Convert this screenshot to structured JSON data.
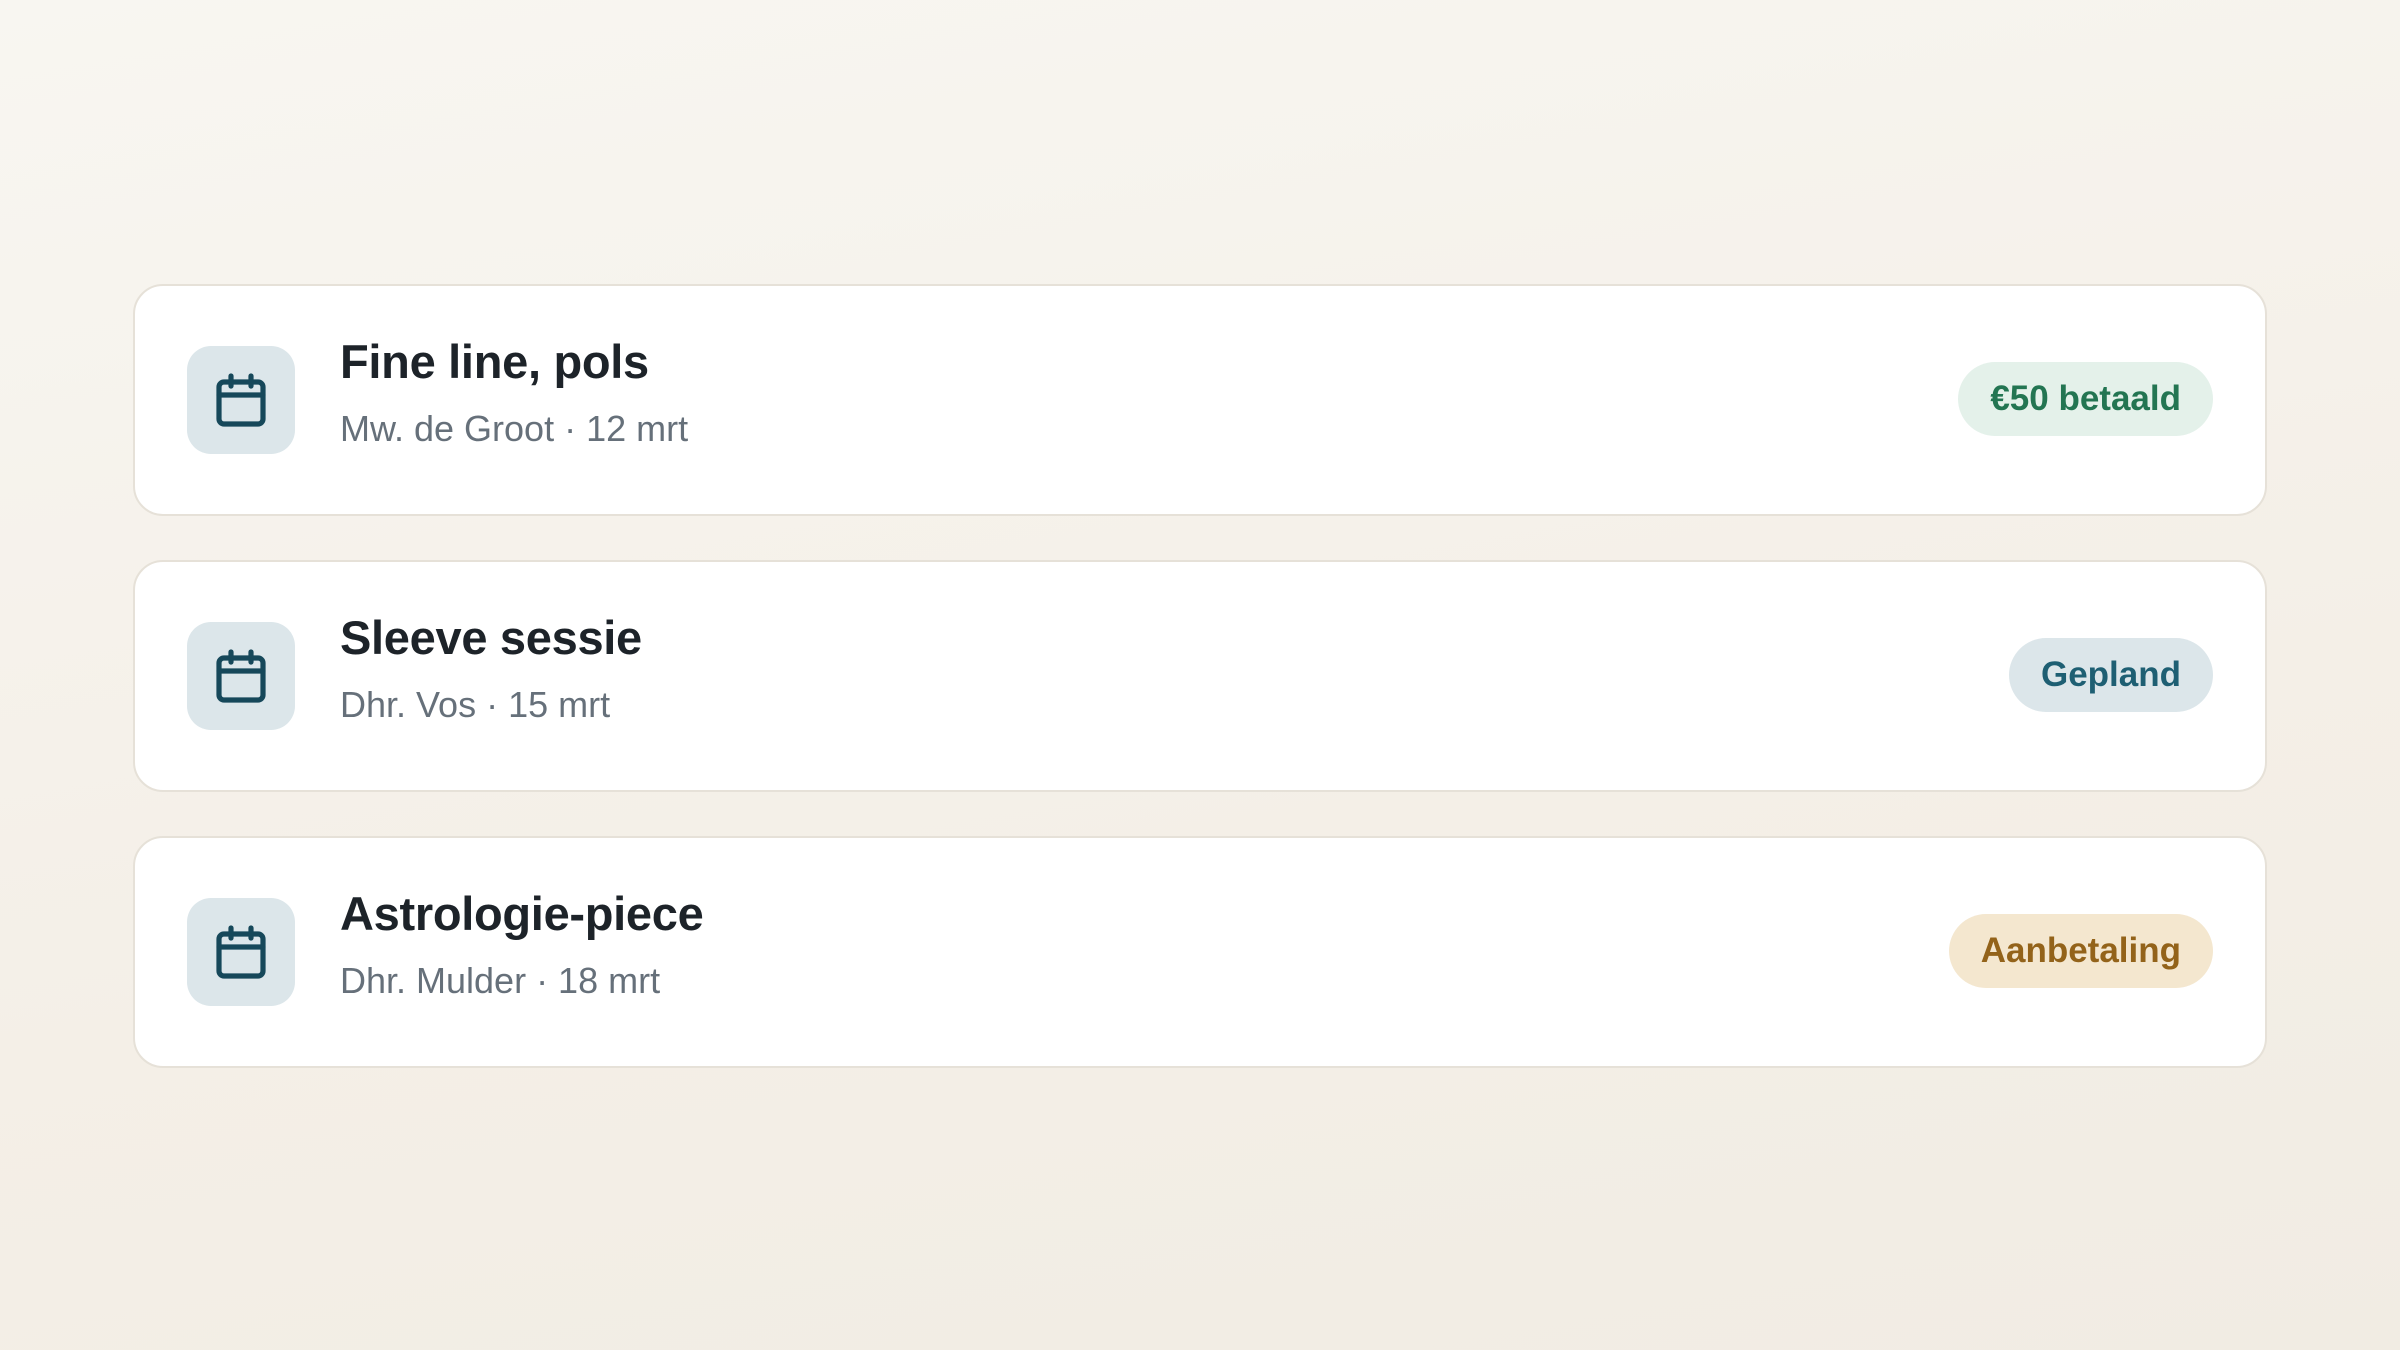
{
  "appointments": [
    {
      "title": "Fine line, pols",
      "client": "Mw. de Groot",
      "date": "12 mrt",
      "subtitle": "Mw. de Groot · 12 mrt",
      "status": "€50 betaald",
      "status_type": "paid",
      "icon": "calendar-icon"
    },
    {
      "title": "Sleeve sessie",
      "client": "Dhr. Vos",
      "date": "15 mrt",
      "subtitle": "Dhr. Vos · 15 mrt",
      "status": "Gepland",
      "status_type": "planned",
      "icon": "calendar-icon"
    },
    {
      "title": "Astrologie-piece",
      "client": "Dhr. Mulder",
      "date": "18 mrt",
      "subtitle": "Dhr. Mulder · 18 mrt",
      "status": "Aanbetaling",
      "status_type": "deposit",
      "icon": "calendar-icon"
    }
  ],
  "colors": {
    "icon_stroke": "#16485a",
    "icon_bg": "#dce6ea",
    "paid_bg": "#e4f1ea",
    "paid_text": "#237552",
    "planned_bg": "#dce6ea",
    "planned_text": "#1e5f73",
    "deposit_bg": "#f4e7cf",
    "deposit_text": "#93631a"
  }
}
